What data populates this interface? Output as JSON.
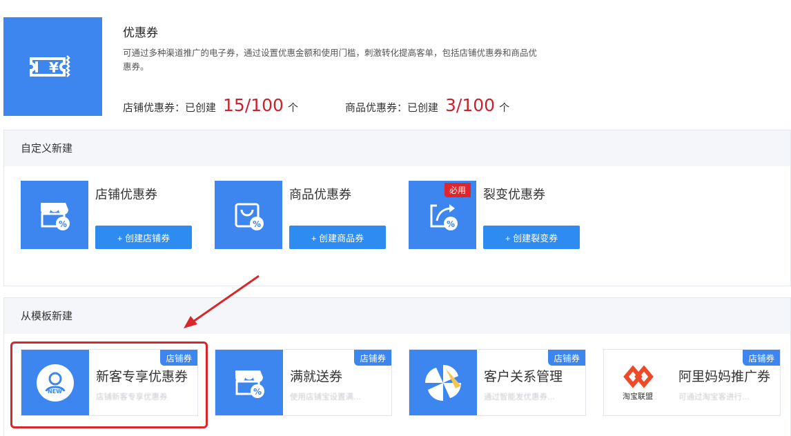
{
  "header": {
    "title": "优惠券",
    "description": "可通过多种渠道推广的电子券，通过设置优惠金额和使用门槛，刺激转化提高客单，包括店铺优惠券和商品优惠券。",
    "stats": [
      {
        "label": "店铺优惠券：已创建",
        "count": "15/100",
        "unit": "个"
      },
      {
        "label": "商品优惠券：已创建",
        "count": "3/100",
        "unit": "个"
      }
    ]
  },
  "custom": {
    "heading": "自定义新建",
    "cards": [
      {
        "title": "店铺优惠券",
        "button": "+ 创建店铺券",
        "icon": "shop-coupon-icon"
      },
      {
        "title": "商品优惠券",
        "button": "+ 创建商品券",
        "icon": "bag-coupon-icon"
      },
      {
        "title": "裂变优惠券",
        "button": "+ 创建裂变券",
        "icon": "share-coupon-icon",
        "badge": "必用"
      }
    ]
  },
  "template": {
    "heading": "从模板新建",
    "cards": [
      {
        "title": "新客专享优惠券",
        "desc": "店铺新客专享优惠券",
        "tag": "店铺券",
        "icon": "new-customer-icon"
      },
      {
        "title": "满就送券",
        "desc": "使用店铺宝设置满...",
        "tag": "店铺券",
        "icon": "shop-coupon-icon"
      },
      {
        "title": "客户关系管理",
        "desc": "通过智能发优惠券...",
        "tag": "店铺券",
        "icon": "pinwheel-icon"
      },
      {
        "title": "阿里妈妈推广券",
        "desc": "可通过淘宝客进行...",
        "tag": "店铺券",
        "icon": "taobao-union-logo",
        "logo_text": "淘宝联盟"
      }
    ]
  },
  "colors": {
    "brand": "#3d86f0",
    "button": "#2e8cf0",
    "count": "#c8232c",
    "highlight": "#d9262a"
  }
}
